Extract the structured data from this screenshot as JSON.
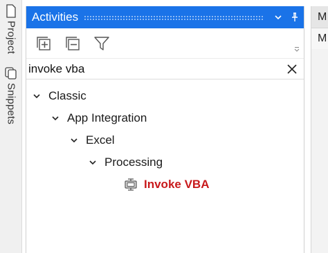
{
  "side_tabs": {
    "project": "Project",
    "snippets": "Snippets"
  },
  "panel": {
    "title": "Activities",
    "accent": "#1a73e8",
    "toolbar": {
      "expand_icon": "expand-all-icon",
      "collapse_icon": "collapse-all-icon",
      "filter_icon": "filter-icon"
    },
    "search": {
      "value": "invoke vba"
    },
    "tree": {
      "nodes": [
        {
          "label": "Classic"
        },
        {
          "label": "App Integration"
        },
        {
          "label": "Excel"
        },
        {
          "label": "Processing"
        }
      ],
      "leaf": {
        "label": "Invoke VBA",
        "color": "#c8191b"
      }
    }
  },
  "right_panel": {
    "tab1": "M",
    "tab2": "M"
  }
}
